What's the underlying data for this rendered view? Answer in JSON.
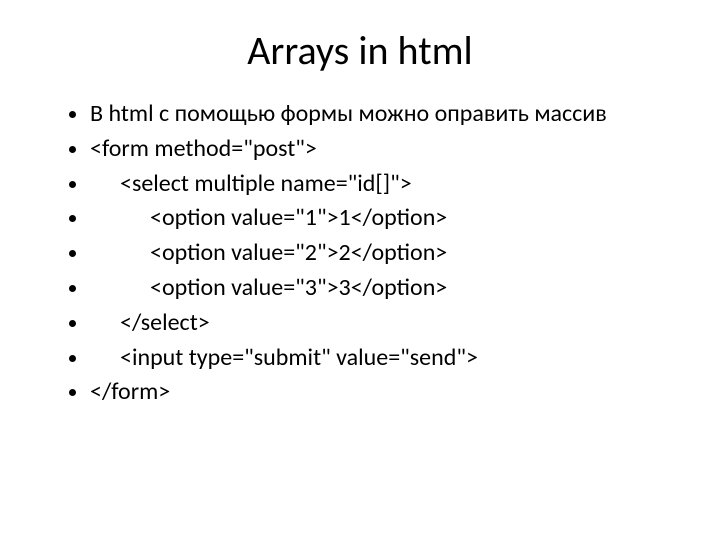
{
  "title": "Arrays in html",
  "bullets": [
    "В html с помощью формы можно оправить массив",
    "<form method=\"post\">",
    "    <select multiple name=\"id[]\">",
    "        <option value=\"1\">1</option>",
    "        <option value=\"2\">2</option>",
    "        <option value=\"3\">3</option>",
    "    </select>",
    "    <input type=\"submit\" value=\"send\">",
    "</form>"
  ]
}
